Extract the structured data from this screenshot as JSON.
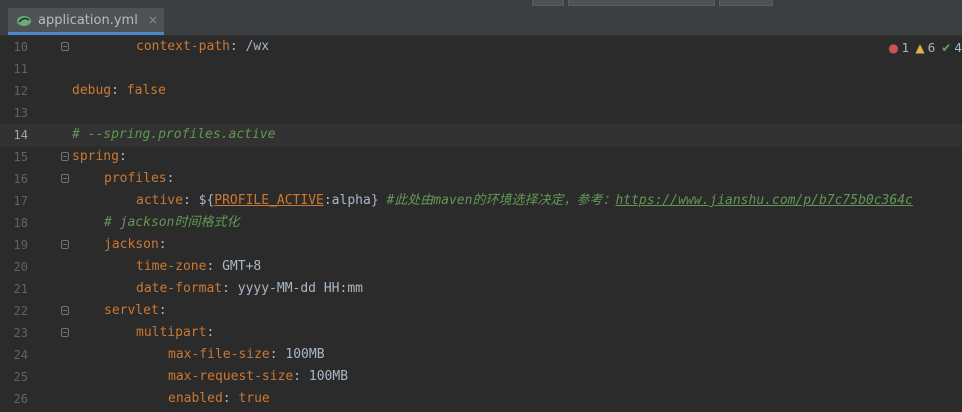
{
  "tab": {
    "label": "application.yml",
    "close": "×"
  },
  "status": {
    "errors": "1",
    "warnings": "6",
    "ok": "4"
  },
  "lines": [
    {
      "num": "10",
      "parts": [
        [
          "k",
          "context-path"
        ],
        [
          "v",
          ": /wx"
        ]
      ]
    },
    {
      "num": "11",
      "parts": []
    },
    {
      "num": "12",
      "parts": [
        [
          "k",
          "debug"
        ],
        [
          "v",
          ": "
        ],
        [
          "k",
          "false"
        ]
      ]
    },
    {
      "num": "13",
      "parts": []
    },
    {
      "num": "14",
      "parts": [
        [
          "c",
          "# --spring.profiles.active"
        ]
      ]
    },
    {
      "num": "15",
      "parts": [
        [
          "k",
          "spring"
        ],
        [
          "v",
          ":"
        ]
      ]
    },
    {
      "num": "16",
      "parts": [
        [
          "k",
          "profiles"
        ],
        [
          "v",
          ":"
        ]
      ]
    },
    {
      "num": "17",
      "parts": [
        [
          "k",
          "active"
        ],
        [
          "v",
          ": ${"
        ],
        [
          "ph",
          "PROFILE_ACTIVE"
        ],
        [
          "v",
          ":alpha} "
        ],
        [
          "c",
          "#此处由maven的环境选择决定，参考："
        ],
        [
          "u",
          "https://www.jianshu.com/p/b7c75b0c364c"
        ]
      ]
    },
    {
      "num": "18",
      "parts": [
        [
          "c",
          "# jackson时间格式化"
        ]
      ]
    },
    {
      "num": "19",
      "parts": [
        [
          "k",
          "jackson"
        ],
        [
          "v",
          ":"
        ]
      ]
    },
    {
      "num": "20",
      "parts": [
        [
          "k",
          "time-zone"
        ],
        [
          "v",
          ": GMT+8"
        ]
      ]
    },
    {
      "num": "21",
      "parts": [
        [
          "k",
          "date-format"
        ],
        [
          "v",
          ": yyyy-MM-dd HH:mm"
        ]
      ]
    },
    {
      "num": "22",
      "parts": [
        [
          "k",
          "servlet"
        ],
        [
          "v",
          ":"
        ]
      ]
    },
    {
      "num": "23",
      "parts": [
        [
          "k",
          "multipart"
        ],
        [
          "v",
          ":"
        ]
      ]
    },
    {
      "num": "24",
      "parts": [
        [
          "k",
          "max-file-size"
        ],
        [
          "v",
          ": 100MB"
        ]
      ]
    },
    {
      "num": "25",
      "parts": [
        [
          "k",
          "max-request-size"
        ],
        [
          "v",
          ": 100MB"
        ]
      ]
    },
    {
      "num": "26",
      "parts": [
        [
          "k",
          "enabled"
        ],
        [
          "v",
          ": "
        ],
        [
          "k",
          "true"
        ]
      ]
    }
  ]
}
